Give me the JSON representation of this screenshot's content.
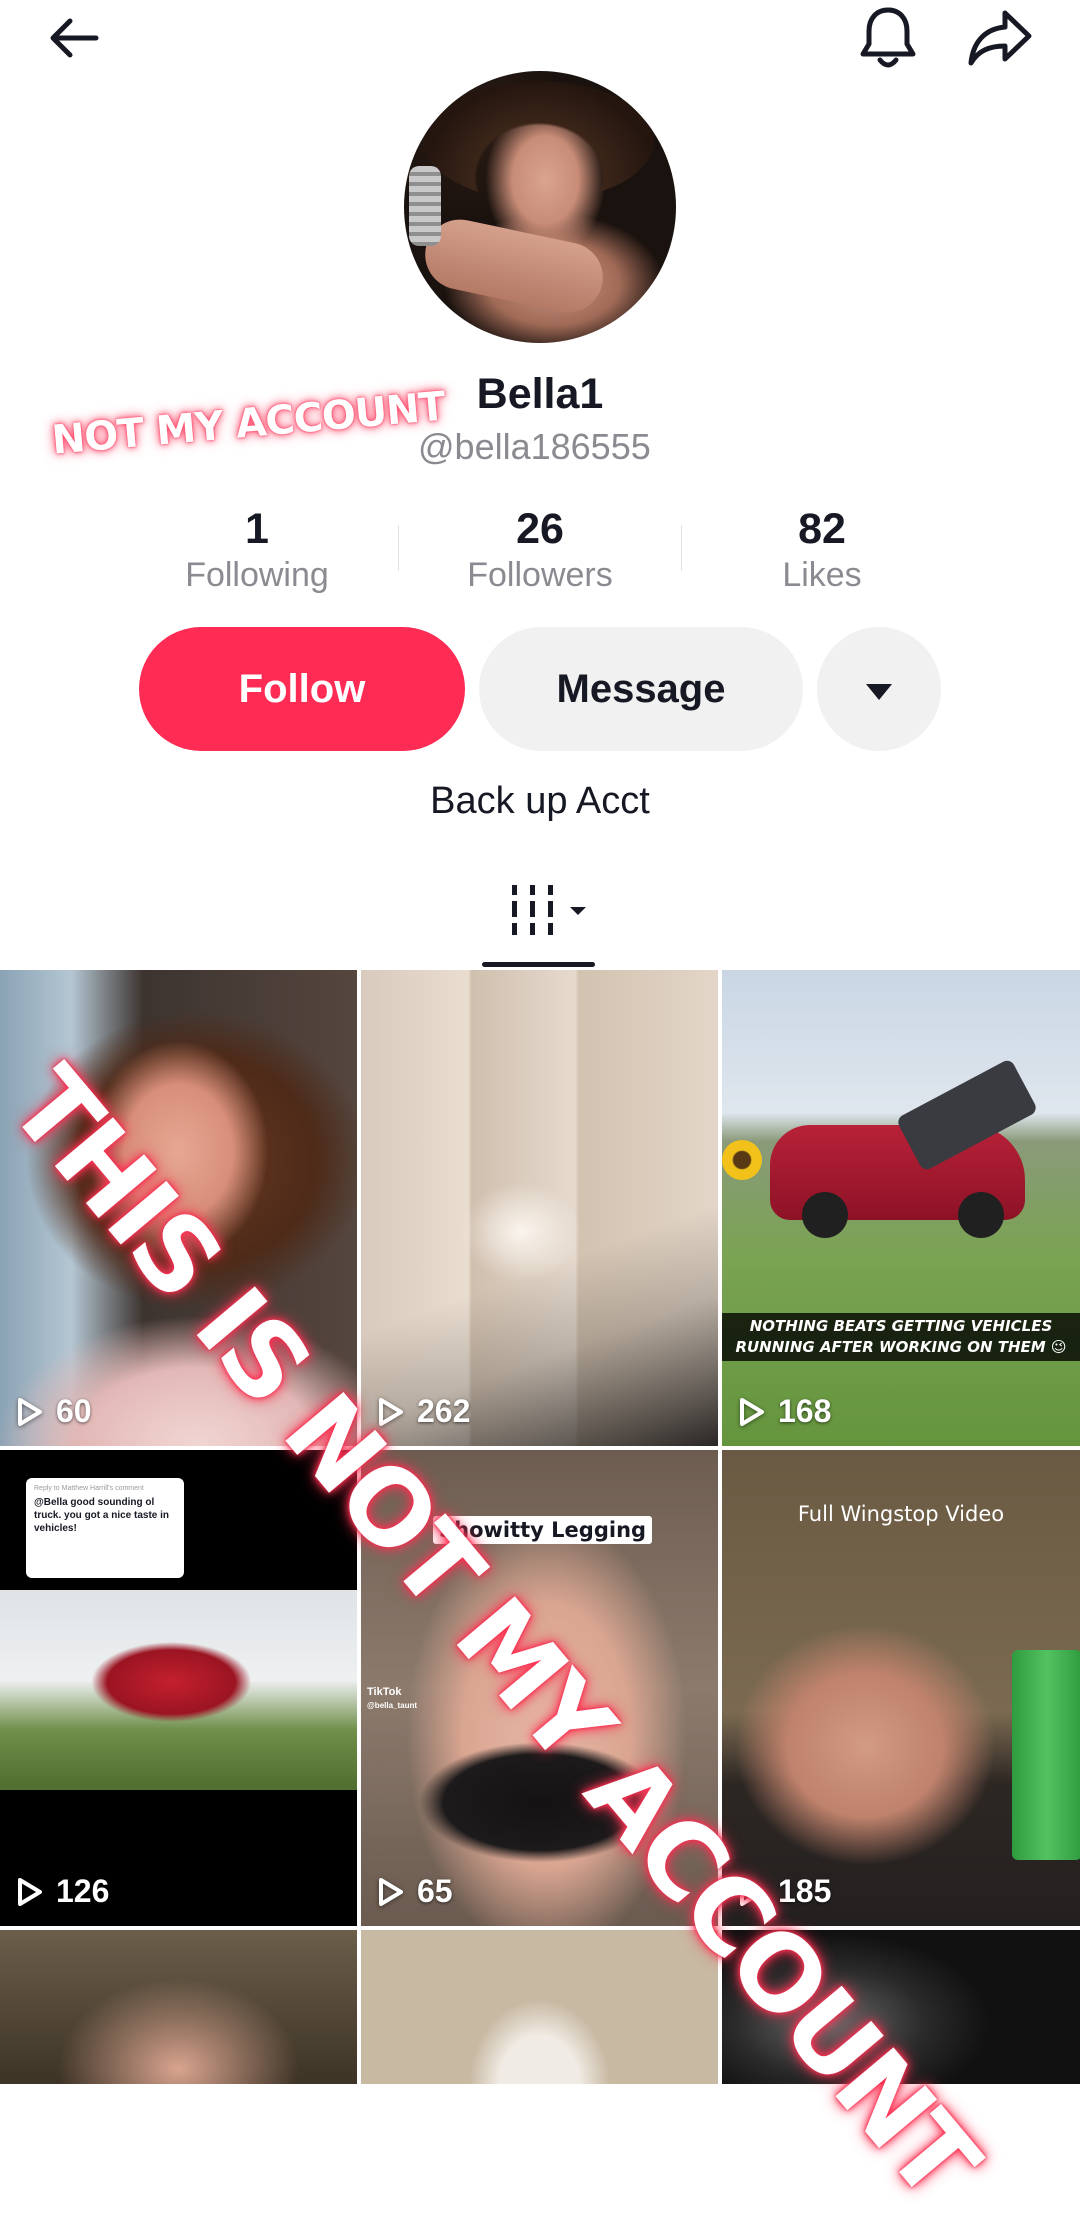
{
  "top_bar": {
    "back_icon": "arrow-left-icon",
    "bell_icon": "bell-icon",
    "share_icon": "share-arrow-icon"
  },
  "profile": {
    "display_name": "Bella1",
    "username": "@bella186555",
    "bio": "Back up Acct"
  },
  "overlays": {
    "small": "NOT MY ACCOUNT",
    "large": "THIS IS NOT MY ACCOUNT"
  },
  "stats": [
    {
      "value": "1",
      "label": "Following"
    },
    {
      "value": "26",
      "label": "Followers"
    },
    {
      "value": "82",
      "label": "Likes"
    }
  ],
  "actions": {
    "follow": "Follow",
    "message": "Message"
  },
  "colors": {
    "accent": "#fe2c55",
    "secondary_button": "#f1f1f2",
    "muted_text": "#8a8b91"
  },
  "videos": [
    {
      "views": "60"
    },
    {
      "views": "262"
    },
    {
      "views": "168",
      "caption": "NOTHING BEATS GETTING VEHICLES RUNNING AFTER WORKING ON THEM 😉"
    },
    {
      "views": "126",
      "reply_header": "Reply to Matthew Harrill's comment",
      "reply_text": "@Bella good sounding ol truck. you got a nice taste in vehicles!"
    },
    {
      "views": "65",
      "caption": "Showitty Legging",
      "watermark": "TikTok",
      "watermark_handle": "@bella_taunt"
    },
    {
      "views": "185",
      "caption": "Full Wingstop Video"
    }
  ]
}
